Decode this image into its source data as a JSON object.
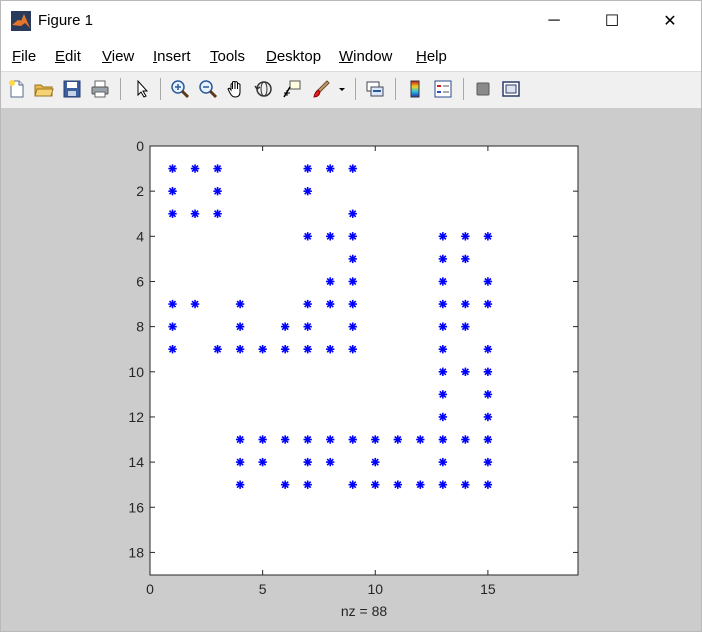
{
  "window": {
    "title": "Figure 1",
    "controls": {
      "minimize": "─",
      "maximize": "☐",
      "close": "✕"
    }
  },
  "menu": {
    "items": [
      {
        "key": "F",
        "rest": "ile"
      },
      {
        "key": "E",
        "rest": "dit"
      },
      {
        "key": "V",
        "rest": "iew"
      },
      {
        "key": "I",
        "rest": "nsert"
      },
      {
        "key": "T",
        "rest": "ools"
      },
      {
        "key": "D",
        "rest": "esktop"
      },
      {
        "key": "W",
        "rest": "indow"
      },
      {
        "key": "H",
        "rest": "elp"
      }
    ],
    "dock_arrow": "↘"
  },
  "toolbar": {
    "icons": [
      "new-figure-icon",
      "open-file-icon",
      "save-icon",
      "print-icon",
      "edit-plot-arrow-icon",
      "zoom-in-icon",
      "zoom-out-icon",
      "pan-hand-icon",
      "rotate-3d-icon",
      "data-cursor-icon",
      "brush-icon",
      "brush-dropdown-icon",
      "link-plot-icon",
      "colorbar-icon",
      "legend-icon",
      "hide-plot-tools-icon",
      "show-plot-tools-icon"
    ]
  },
  "chart_data": {
    "type": "scatter",
    "xlabel": "nz = 88",
    "marker_color": "#0000ff",
    "marker": "*",
    "y_reversed": true,
    "xlim": [
      0,
      19
    ],
    "ylim": [
      0,
      19
    ],
    "xticks": [
      0,
      5,
      10,
      15
    ],
    "yticks": [
      0,
      2,
      4,
      6,
      8,
      10,
      12,
      14,
      16,
      18
    ],
    "grid": false,
    "points": [
      [
        1,
        1
      ],
      [
        2,
        1
      ],
      [
        3,
        1
      ],
      [
        7,
        1
      ],
      [
        8,
        1
      ],
      [
        9,
        1
      ],
      [
        1,
        2
      ],
      [
        3,
        2
      ],
      [
        7,
        2
      ],
      [
        1,
        3
      ],
      [
        2,
        3
      ],
      [
        3,
        3
      ],
      [
        9,
        3
      ],
      [
        7,
        4
      ],
      [
        8,
        4
      ],
      [
        9,
        4
      ],
      [
        13,
        4
      ],
      [
        14,
        4
      ],
      [
        15,
        4
      ],
      [
        9,
        5
      ],
      [
        13,
        5
      ],
      [
        14,
        5
      ],
      [
        8,
        6
      ],
      [
        9,
        6
      ],
      [
        13,
        6
      ],
      [
        15,
        6
      ],
      [
        1,
        7
      ],
      [
        2,
        7
      ],
      [
        4,
        7
      ],
      [
        7,
        7
      ],
      [
        8,
        7
      ],
      [
        9,
        7
      ],
      [
        13,
        7
      ],
      [
        14,
        7
      ],
      [
        15,
        7
      ],
      [
        1,
        8
      ],
      [
        4,
        8
      ],
      [
        6,
        8
      ],
      [
        7,
        8
      ],
      [
        9,
        8
      ],
      [
        13,
        8
      ],
      [
        14,
        8
      ],
      [
        1,
        9
      ],
      [
        3,
        9
      ],
      [
        4,
        9
      ],
      [
        5,
        9
      ],
      [
        6,
        9
      ],
      [
        7,
        9
      ],
      [
        8,
        9
      ],
      [
        9,
        9
      ],
      [
        13,
        9
      ],
      [
        15,
        9
      ],
      [
        13,
        10
      ],
      [
        14,
        10
      ],
      [
        15,
        10
      ],
      [
        13,
        11
      ],
      [
        15,
        11
      ],
      [
        13,
        12
      ],
      [
        15,
        12
      ],
      [
        4,
        13
      ],
      [
        5,
        13
      ],
      [
        6,
        13
      ],
      [
        7,
        13
      ],
      [
        8,
        13
      ],
      [
        9,
        13
      ],
      [
        10,
        13
      ],
      [
        11,
        13
      ],
      [
        12,
        13
      ],
      [
        13,
        13
      ],
      [
        14,
        13
      ],
      [
        15,
        13
      ],
      [
        4,
        14
      ],
      [
        5,
        14
      ],
      [
        7,
        14
      ],
      [
        8,
        14
      ],
      [
        10,
        14
      ],
      [
        13,
        14
      ],
      [
        15,
        14
      ],
      [
        4,
        15
      ],
      [
        6,
        15
      ],
      [
        7,
        15
      ],
      [
        9,
        15
      ],
      [
        10,
        15
      ],
      [
        11,
        15
      ],
      [
        12,
        15
      ],
      [
        13,
        15
      ],
      [
        14,
        15
      ],
      [
        15,
        15
      ]
    ]
  }
}
